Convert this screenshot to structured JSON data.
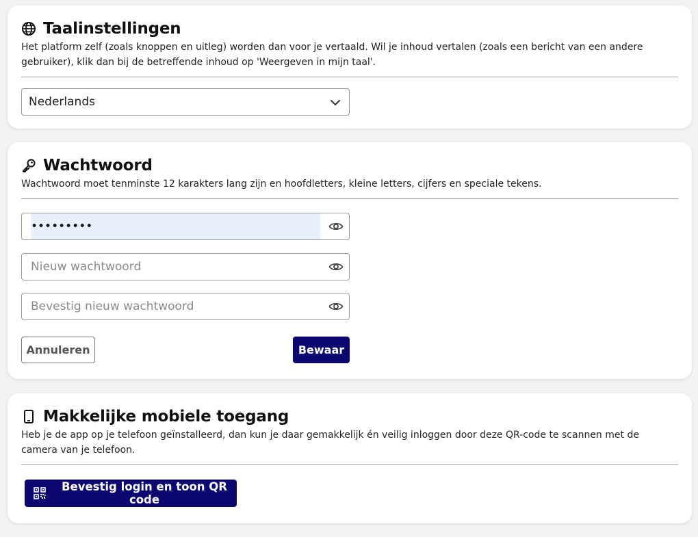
{
  "language": {
    "title": "Taalinstellingen",
    "icon": "globe-icon",
    "description": "Het platform zelf (zoals knoppen en uitleg) worden dan voor je vertaald. Wil je inhoud vertalen (zoals een bericht van een andere gebruiker), klik dan bij de betreffende inhoud op 'Weergeven in mijn taal'.",
    "selected": "Nederlands"
  },
  "password": {
    "title": "Wachtwoord",
    "icon": "key-icon",
    "description": "Wachtwoord moet tenminste 12 karakters lang zijn en hoofdletters, kleine letters, cijfers en speciale tekens.",
    "current_value": "•••••••••",
    "new_placeholder": "Nieuw wachtwoord",
    "confirm_placeholder": "Bevestig nieuw wachtwoord",
    "cancel_label": "Annuleren",
    "save_label": "Bewaar"
  },
  "mobile": {
    "title": "Makkelijke mobiele toegang",
    "icon": "phone-icon",
    "description": "Heb je de app op je telefoon geïnstalleerd, dan kun je daar gemakkelijk én veilig inloggen door deze QR-code te scannen met de camera van je telefoon.",
    "qr_button_label": "Bevestig login en toon QR code"
  },
  "colors": {
    "primary": "#0c0870",
    "autofill": "#e8f0fe",
    "background": "#f2f2f2"
  }
}
